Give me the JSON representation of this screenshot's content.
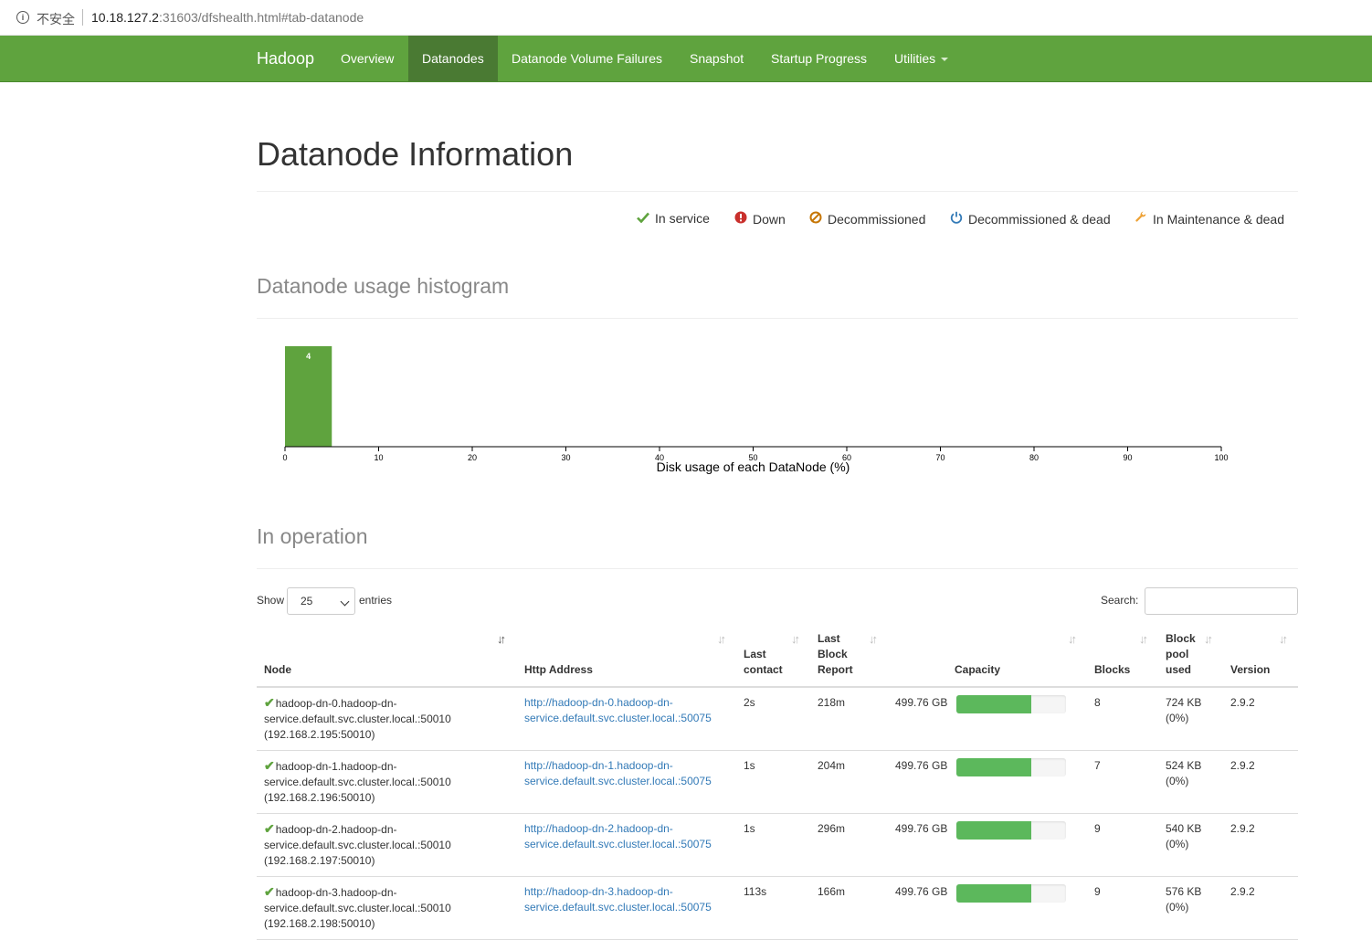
{
  "browser": {
    "security_label": "不安全",
    "url_host": "10.18.127.2",
    "url_rest": ":31603/dfshealth.html#tab-datanode"
  },
  "navbar": {
    "brand": "Hadoop",
    "items": [
      {
        "label": "Overview",
        "active": false
      },
      {
        "label": "Datanodes",
        "active": true
      },
      {
        "label": "Datanode Volume Failures",
        "active": false
      },
      {
        "label": "Snapshot",
        "active": false
      },
      {
        "label": "Startup Progress",
        "active": false
      },
      {
        "label": "Utilities",
        "active": false,
        "dropdown": true
      }
    ]
  },
  "page": {
    "title": "Datanode Information",
    "legend": [
      {
        "icon": "check-icon",
        "label": "In service",
        "color": "#5fa33e"
      },
      {
        "icon": "exclamation-circle-icon",
        "label": "Down",
        "color": "#c9302c"
      },
      {
        "icon": "ban-icon",
        "label": "Decommissioned",
        "color": "#c67605"
      },
      {
        "icon": "power-icon",
        "label": "Decommissioned & dead",
        "color": "#337ab7"
      },
      {
        "icon": "wrench-icon",
        "label": "In Maintenance & dead",
        "color": "#eea236"
      }
    ]
  },
  "histogram": {
    "heading": "Datanode usage histogram",
    "chart_data": {
      "type": "bar",
      "xlabel": "Disk usage of each DataNode (%)",
      "xlim": [
        0,
        100
      ],
      "x_ticks": [
        0,
        10,
        20,
        30,
        40,
        50,
        60,
        70,
        80,
        90,
        100
      ],
      "bins": [
        {
          "x0": 0,
          "x1": 5,
          "count": 4
        }
      ],
      "bar_color": "#5fa33e"
    }
  },
  "operation": {
    "heading": "In operation",
    "show_label": "Show",
    "page_size": "25",
    "entries_label": "entries",
    "search_label": "Search:",
    "search_value": "",
    "columns": {
      "node": "Node",
      "http": "Http Address",
      "last_contact": [
        "Last",
        "contact"
      ],
      "last_block": [
        "Last",
        "Block",
        "Report"
      ],
      "capacity": "Capacity",
      "blocks": "Blocks",
      "pool": [
        "Block",
        "pool",
        "used"
      ],
      "version": "Version"
    },
    "rows": [
      {
        "node": [
          "hadoop-dn-0.hadoop-dn-",
          "service.default.svc.cluster.local.:50010",
          "(192.168.2.195:50010)"
        ],
        "http": [
          "http://hadoop-dn-0.hadoop-dn-",
          "service.default.svc.cluster.local.:50075"
        ],
        "last_contact": "2s",
        "last_block": "218m",
        "capacity": "499.76 GB",
        "used_fraction": 0.68,
        "blocks": "8",
        "pool": [
          "724 KB",
          "(0%)"
        ],
        "version": "2.9.2"
      },
      {
        "node": [
          "hadoop-dn-1.hadoop-dn-",
          "service.default.svc.cluster.local.:50010",
          "(192.168.2.196:50010)"
        ],
        "http": [
          "http://hadoop-dn-1.hadoop-dn-",
          "service.default.svc.cluster.local.:50075"
        ],
        "last_contact": "1s",
        "last_block": "204m",
        "capacity": "499.76 GB",
        "used_fraction": 0.68,
        "blocks": "7",
        "pool": [
          "524 KB",
          "(0%)"
        ],
        "version": "2.9.2"
      },
      {
        "node": [
          "hadoop-dn-2.hadoop-dn-",
          "service.default.svc.cluster.local.:50010",
          "(192.168.2.197:50010)"
        ],
        "http": [
          "http://hadoop-dn-2.hadoop-dn-",
          "service.default.svc.cluster.local.:50075"
        ],
        "last_contact": "1s",
        "last_block": "296m",
        "capacity": "499.76 GB",
        "used_fraction": 0.68,
        "blocks": "9",
        "pool": [
          "540 KB",
          "(0%)"
        ],
        "version": "2.9.2"
      },
      {
        "node": [
          "hadoop-dn-3.hadoop-dn-",
          "service.default.svc.cluster.local.:50010",
          "(192.168.2.198:50010)"
        ],
        "http": [
          "http://hadoop-dn-3.hadoop-dn-",
          "service.default.svc.cluster.local.:50075"
        ],
        "last_contact": "113s",
        "last_block": "166m",
        "capacity": "499.76 GB",
        "used_fraction": 0.68,
        "blocks": "9",
        "pool": [
          "576 KB",
          "(0%)"
        ],
        "version": "2.9.2"
      }
    ]
  }
}
